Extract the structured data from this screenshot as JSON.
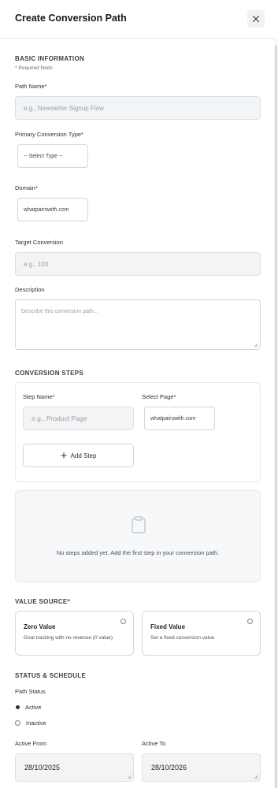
{
  "header": {
    "title": "Create Conversion Path"
  },
  "basic": {
    "heading": "BASIC INFORMATION",
    "required_note": "* Required fields",
    "path_name_label": "Path Name*",
    "path_name_placeholder": "e.g., Newsletter Signup Flow",
    "conversion_type_label": "Primary Conversion Type*",
    "conversion_type_value": "-- Select Type --",
    "domain_label": "Domain*",
    "domain_value": "whatpairswith.com",
    "target_label": "Target Conversion",
    "target_placeholder": "e.g., 100",
    "description_label": "Description",
    "description_placeholder": "Describe this conversion path..."
  },
  "steps": {
    "heading": "CONVERSION STEPS",
    "step_name_label": "Step Name*",
    "step_name_placeholder": "e.g., Product Page",
    "select_page_label": "Select Page*",
    "select_page_value": "whatpairswith.com",
    "add_step_label": "Add Step",
    "empty_message": "No steps added yet. Add the first step in your conversion path."
  },
  "value_source": {
    "heading": "VALUE SOURCE*",
    "options": [
      {
        "title": "Zero Value",
        "desc": "Goal tracking with no revenue (0 value)"
      },
      {
        "title": "Fixed Value",
        "desc": "Set a fixed conversion value"
      }
    ]
  },
  "status": {
    "heading": "STATUS & SCHEDULE",
    "path_status_label": "Path Status",
    "options": [
      "Active",
      "Inactive"
    ],
    "selected": "Active",
    "active_from_label": "Active From",
    "active_from_value": "28/10/2025",
    "active_to_label": "Active To",
    "active_to_value": "28/10/2026"
  }
}
